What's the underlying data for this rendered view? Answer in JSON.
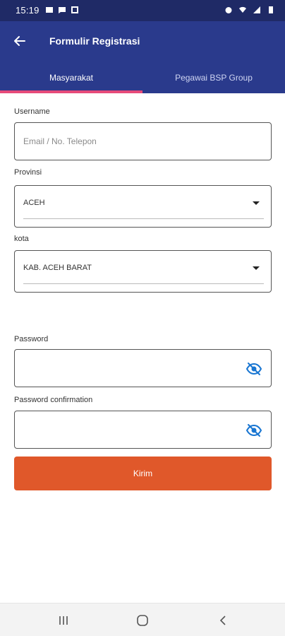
{
  "status_bar": {
    "time": "15:19",
    "left_icons": [
      "gallery-icon",
      "message-icon",
      "notification-icon"
    ],
    "right_icons": [
      "alarm-icon",
      "wifi-icon",
      "signal-icon",
      "battery-icon"
    ]
  },
  "app_bar": {
    "title": "Formulir Registrasi",
    "back_icon": "arrow-left-icon"
  },
  "tabs": [
    {
      "label": "Masyarakat",
      "active": true
    },
    {
      "label": "Pegawai BSP Group",
      "active": false
    }
  ],
  "form": {
    "username": {
      "label": "Username",
      "value": "",
      "placeholder": "Email / No. Telepon"
    },
    "province": {
      "label": "Provinsi",
      "selected": "ACEH"
    },
    "city": {
      "label": "kota",
      "selected": "KAB. ACEH BARAT"
    },
    "password": {
      "label": "Password",
      "value": ""
    },
    "password_confirmation": {
      "label": "Password confirmation",
      "value": ""
    },
    "submit_label": "Kirim"
  },
  "colors": {
    "header": "#2a3a8c",
    "status_bar": "#1f2a66",
    "tab_indicator": "#e64b7a",
    "submit": "#e0582a",
    "eye_icon": "#1976d2"
  },
  "nav_bar": {
    "buttons": [
      "recent-apps-icon",
      "home-icon",
      "back-icon"
    ]
  }
}
